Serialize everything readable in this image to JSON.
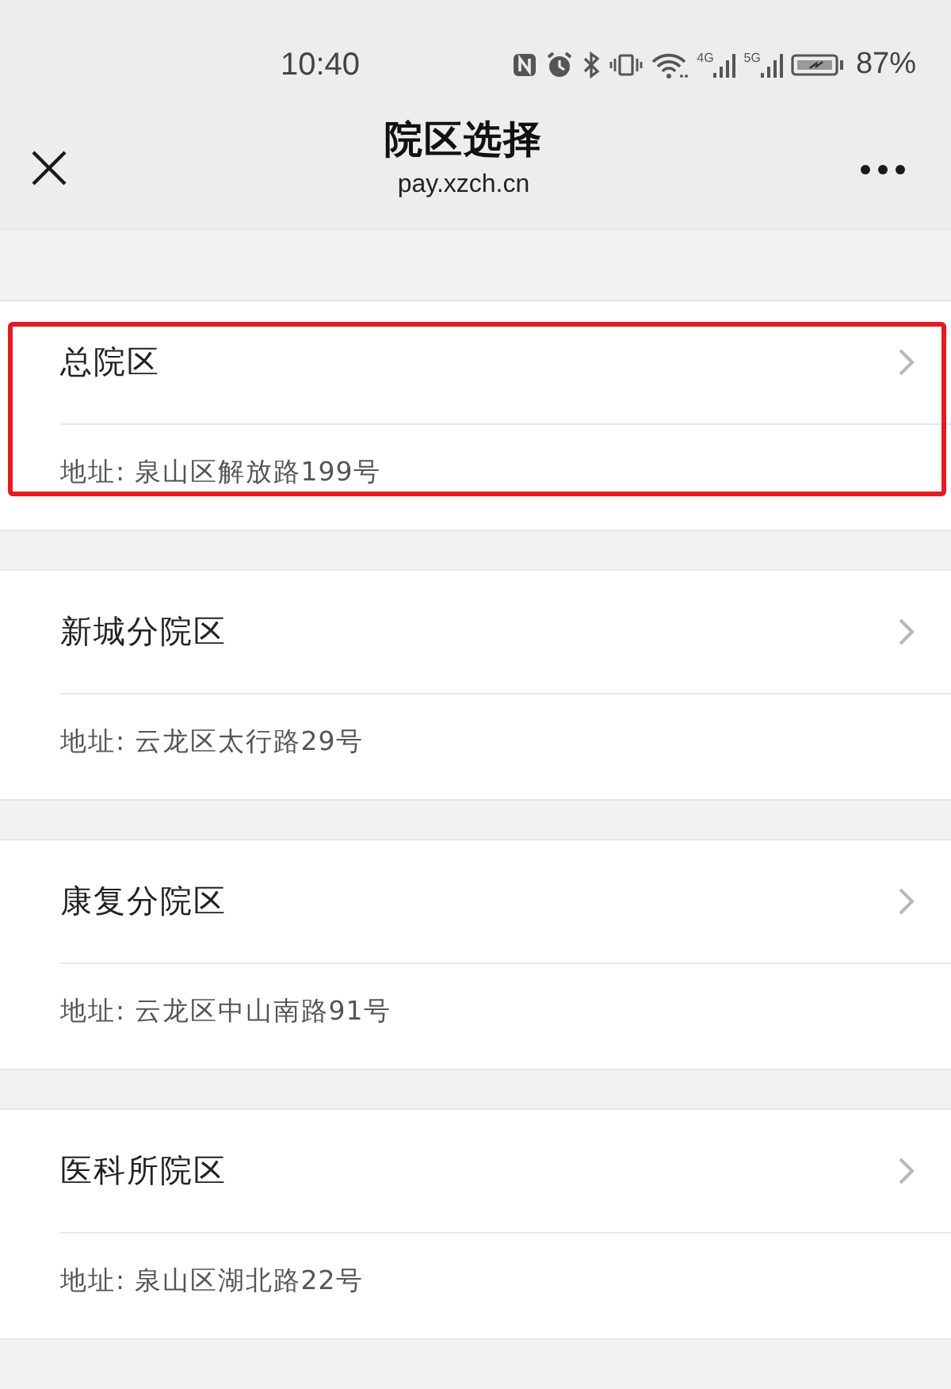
{
  "status_bar": {
    "time": "10:40",
    "networks": [
      {
        "label": "4G"
      },
      {
        "label": "5G"
      }
    ],
    "battery": "87%"
  },
  "header": {
    "title": "院区选择",
    "subtitle": "pay.xzch.cn"
  },
  "campuses": [
    {
      "name": "总院区",
      "address": "地址: 泉山区解放路199号",
      "highlighted": true
    },
    {
      "name": "新城分院区",
      "address": "地址: 云龙区太行路29号",
      "highlighted": false
    },
    {
      "name": "康复分院区",
      "address": "地址: 云龙区中山南路91号",
      "highlighted": false
    },
    {
      "name": "医科所院区",
      "address": "地址: 泉山区湖北路22号",
      "highlighted": false
    }
  ]
}
